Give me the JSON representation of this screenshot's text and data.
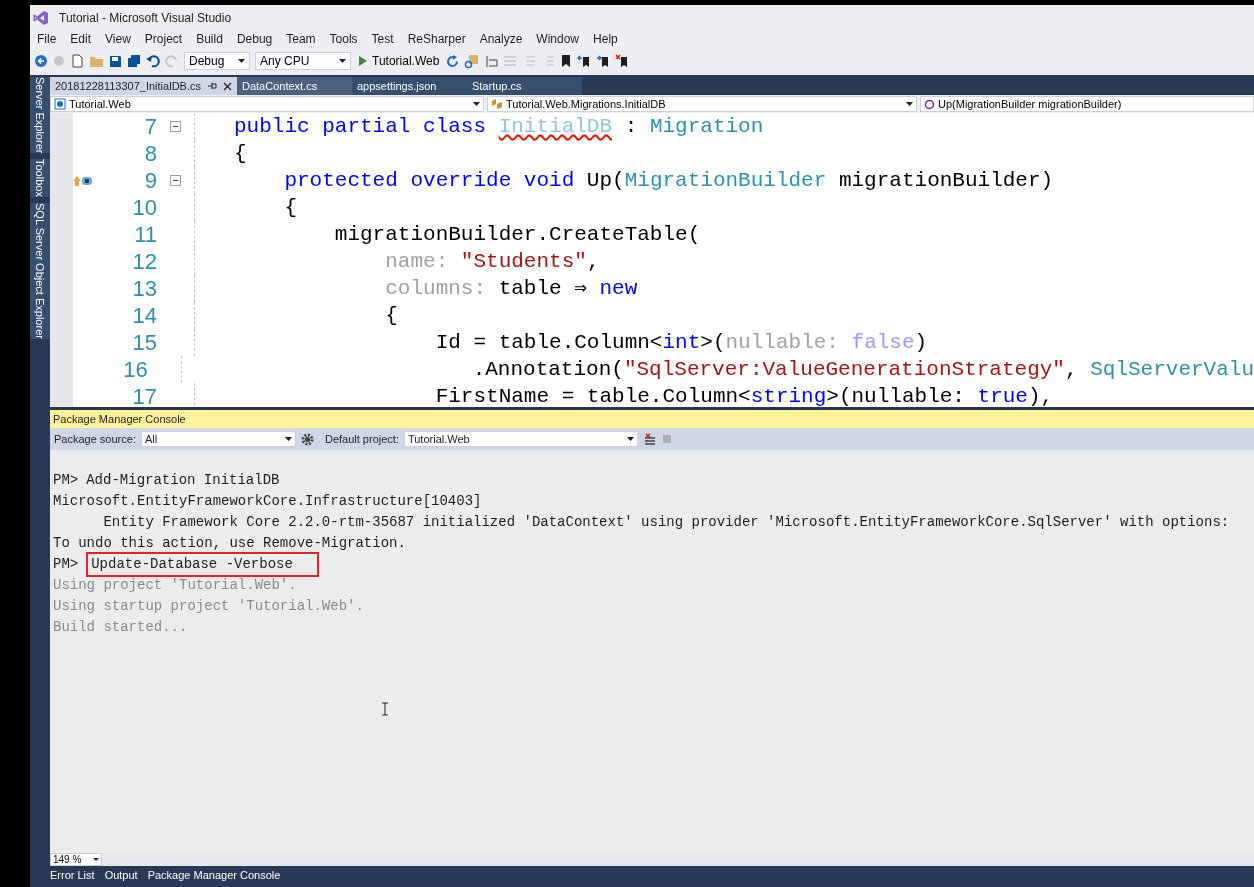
{
  "window": {
    "title": "Tutorial - Microsoft Visual Studio"
  },
  "menu": [
    "File",
    "Edit",
    "View",
    "Project",
    "Build",
    "Debug",
    "Team",
    "Tools",
    "Test",
    "ReSharper",
    "Analyze",
    "Window",
    "Help"
  ],
  "toolbar": {
    "configuration": "Debug",
    "platform": "Any CPU",
    "start_target": "Tutorial.Web"
  },
  "side_tabs": [
    "Server Explorer",
    "Toolbox",
    "SQL Server Object Explorer"
  ],
  "doc_tabs": [
    {
      "label": "20181228113307_InitialDB.cs",
      "selected": true,
      "pinned": true
    },
    {
      "label": "DataContext.cs",
      "selected": false,
      "pinned": false
    },
    {
      "label": "appsettings.json",
      "selected": false,
      "pinned": false
    },
    {
      "label": "Startup.cs",
      "selected": false,
      "pinned": false
    }
  ],
  "nav_bar": {
    "project": "Tutorial.Web",
    "type": "Tutorial.Web.Migrations.InitialDB",
    "member": "Up(MigrationBuilder migrationBuilder)"
  },
  "editor": {
    "lines": [
      {
        "number": "7",
        "foldable": true,
        "marker": false,
        "tokens": [
          {
            "kind": "keyword",
            "text": "public partial class "
          },
          {
            "kind": "unused",
            "text": "InitialDB"
          },
          {
            "kind": "plain",
            "text": " : "
          },
          {
            "kind": "type",
            "text": "Migration"
          }
        ]
      },
      {
        "number": "8",
        "foldable": false,
        "marker": false,
        "tokens": [
          {
            "kind": "plain",
            "text": "{"
          }
        ]
      },
      {
        "number": "9",
        "foldable": true,
        "marker": true,
        "tokens": [
          {
            "kind": "keyword",
            "text": "    protected override void "
          },
          {
            "kind": "plain",
            "text": "Up("
          },
          {
            "kind": "type",
            "text": "MigrationBuilder"
          },
          {
            "kind": "plain",
            "text": " migrationBuilder)"
          }
        ]
      },
      {
        "number": "10",
        "foldable": false,
        "marker": false,
        "tokens": [
          {
            "kind": "plain",
            "text": "    {"
          }
        ]
      },
      {
        "number": "11",
        "foldable": false,
        "marker": false,
        "tokens": [
          {
            "kind": "plain",
            "text": "        migrationBuilder.CreateTable("
          }
        ]
      },
      {
        "number": "12",
        "foldable": false,
        "marker": false,
        "tokens": [
          {
            "kind": "param",
            "text": "            name: "
          },
          {
            "kind": "string",
            "text": "\"Students\""
          },
          {
            "kind": "plain",
            "text": ","
          }
        ]
      },
      {
        "number": "13",
        "foldable": false,
        "marker": false,
        "tokens": [
          {
            "kind": "param",
            "text": "            columns: "
          },
          {
            "kind": "plain",
            "text": "table ⇒ "
          },
          {
            "kind": "keyword",
            "text": "new"
          }
        ]
      },
      {
        "number": "14",
        "foldable": false,
        "marker": false,
        "tokens": [
          {
            "kind": "plain",
            "text": "            {"
          }
        ]
      },
      {
        "number": "15",
        "foldable": false,
        "marker": false,
        "tokens": [
          {
            "kind": "plain",
            "text": "                Id = table.Column<"
          },
          {
            "kind": "keyword",
            "text": "int"
          },
          {
            "kind": "plain",
            "text": ">("
          },
          {
            "kind": "param",
            "text": "nullable: "
          },
          {
            "kind": "faded",
            "text": "false"
          },
          {
            "kind": "plain",
            "text": ")"
          }
        ]
      },
      {
        "number": "16",
        "foldable": false,
        "marker": false,
        "tokens": [
          {
            "kind": "plain",
            "text": "                    .Annotation("
          },
          {
            "kind": "string",
            "text": "\"SqlServer:ValueGenerationStrategy\""
          },
          {
            "kind": "plain",
            "text": ", "
          },
          {
            "kind": "type",
            "text": "SqlServerValu"
          }
        ]
      },
      {
        "number": "17",
        "foldable": false,
        "marker": false,
        "tokens": [
          {
            "kind": "plain",
            "text": "                FirstName = table.Column<"
          },
          {
            "kind": "keyword",
            "text": "string"
          },
          {
            "kind": "plain",
            "text": ">(nullable: "
          },
          {
            "kind": "keyword",
            "text": "true"
          },
          {
            "kind": "plain",
            "text": "),"
          }
        ]
      }
    ]
  },
  "console": {
    "title": "Package Manager Console",
    "source_label": "Package source:",
    "source": "All",
    "project_label": "Default project:",
    "project": "Tutorial.Web",
    "lines": [
      {
        "kind": "command",
        "prompt": "PM>",
        "text": "Add-Migration InitialDB"
      },
      {
        "kind": "output",
        "text": "Microsoft.EntityFrameworkCore.Infrastructure[10403]"
      },
      {
        "kind": "output",
        "text": "      Entity Framework Core 2.2.0-rtm-35687 initialized 'DataContext' using provider 'Microsoft.EntityFrameworkCore.SqlServer' with options:"
      },
      {
        "kind": "output",
        "text": "To undo this action, use Remove-Migration."
      },
      {
        "kind": "command",
        "prompt": "PM>",
        "text": "Update-Database -Verbose",
        "highlighted": true
      },
      {
        "kind": "info",
        "text": "Using project 'Tutorial.Web'."
      },
      {
        "kind": "info",
        "text": "Using startup project 'Tutorial.Web'."
      },
      {
        "kind": "info",
        "text": "Build started..."
      }
    ]
  },
  "zoom": "149 %",
  "bottom_tabs": [
    "Error List",
    "Output",
    "Package Manager Console"
  ]
}
